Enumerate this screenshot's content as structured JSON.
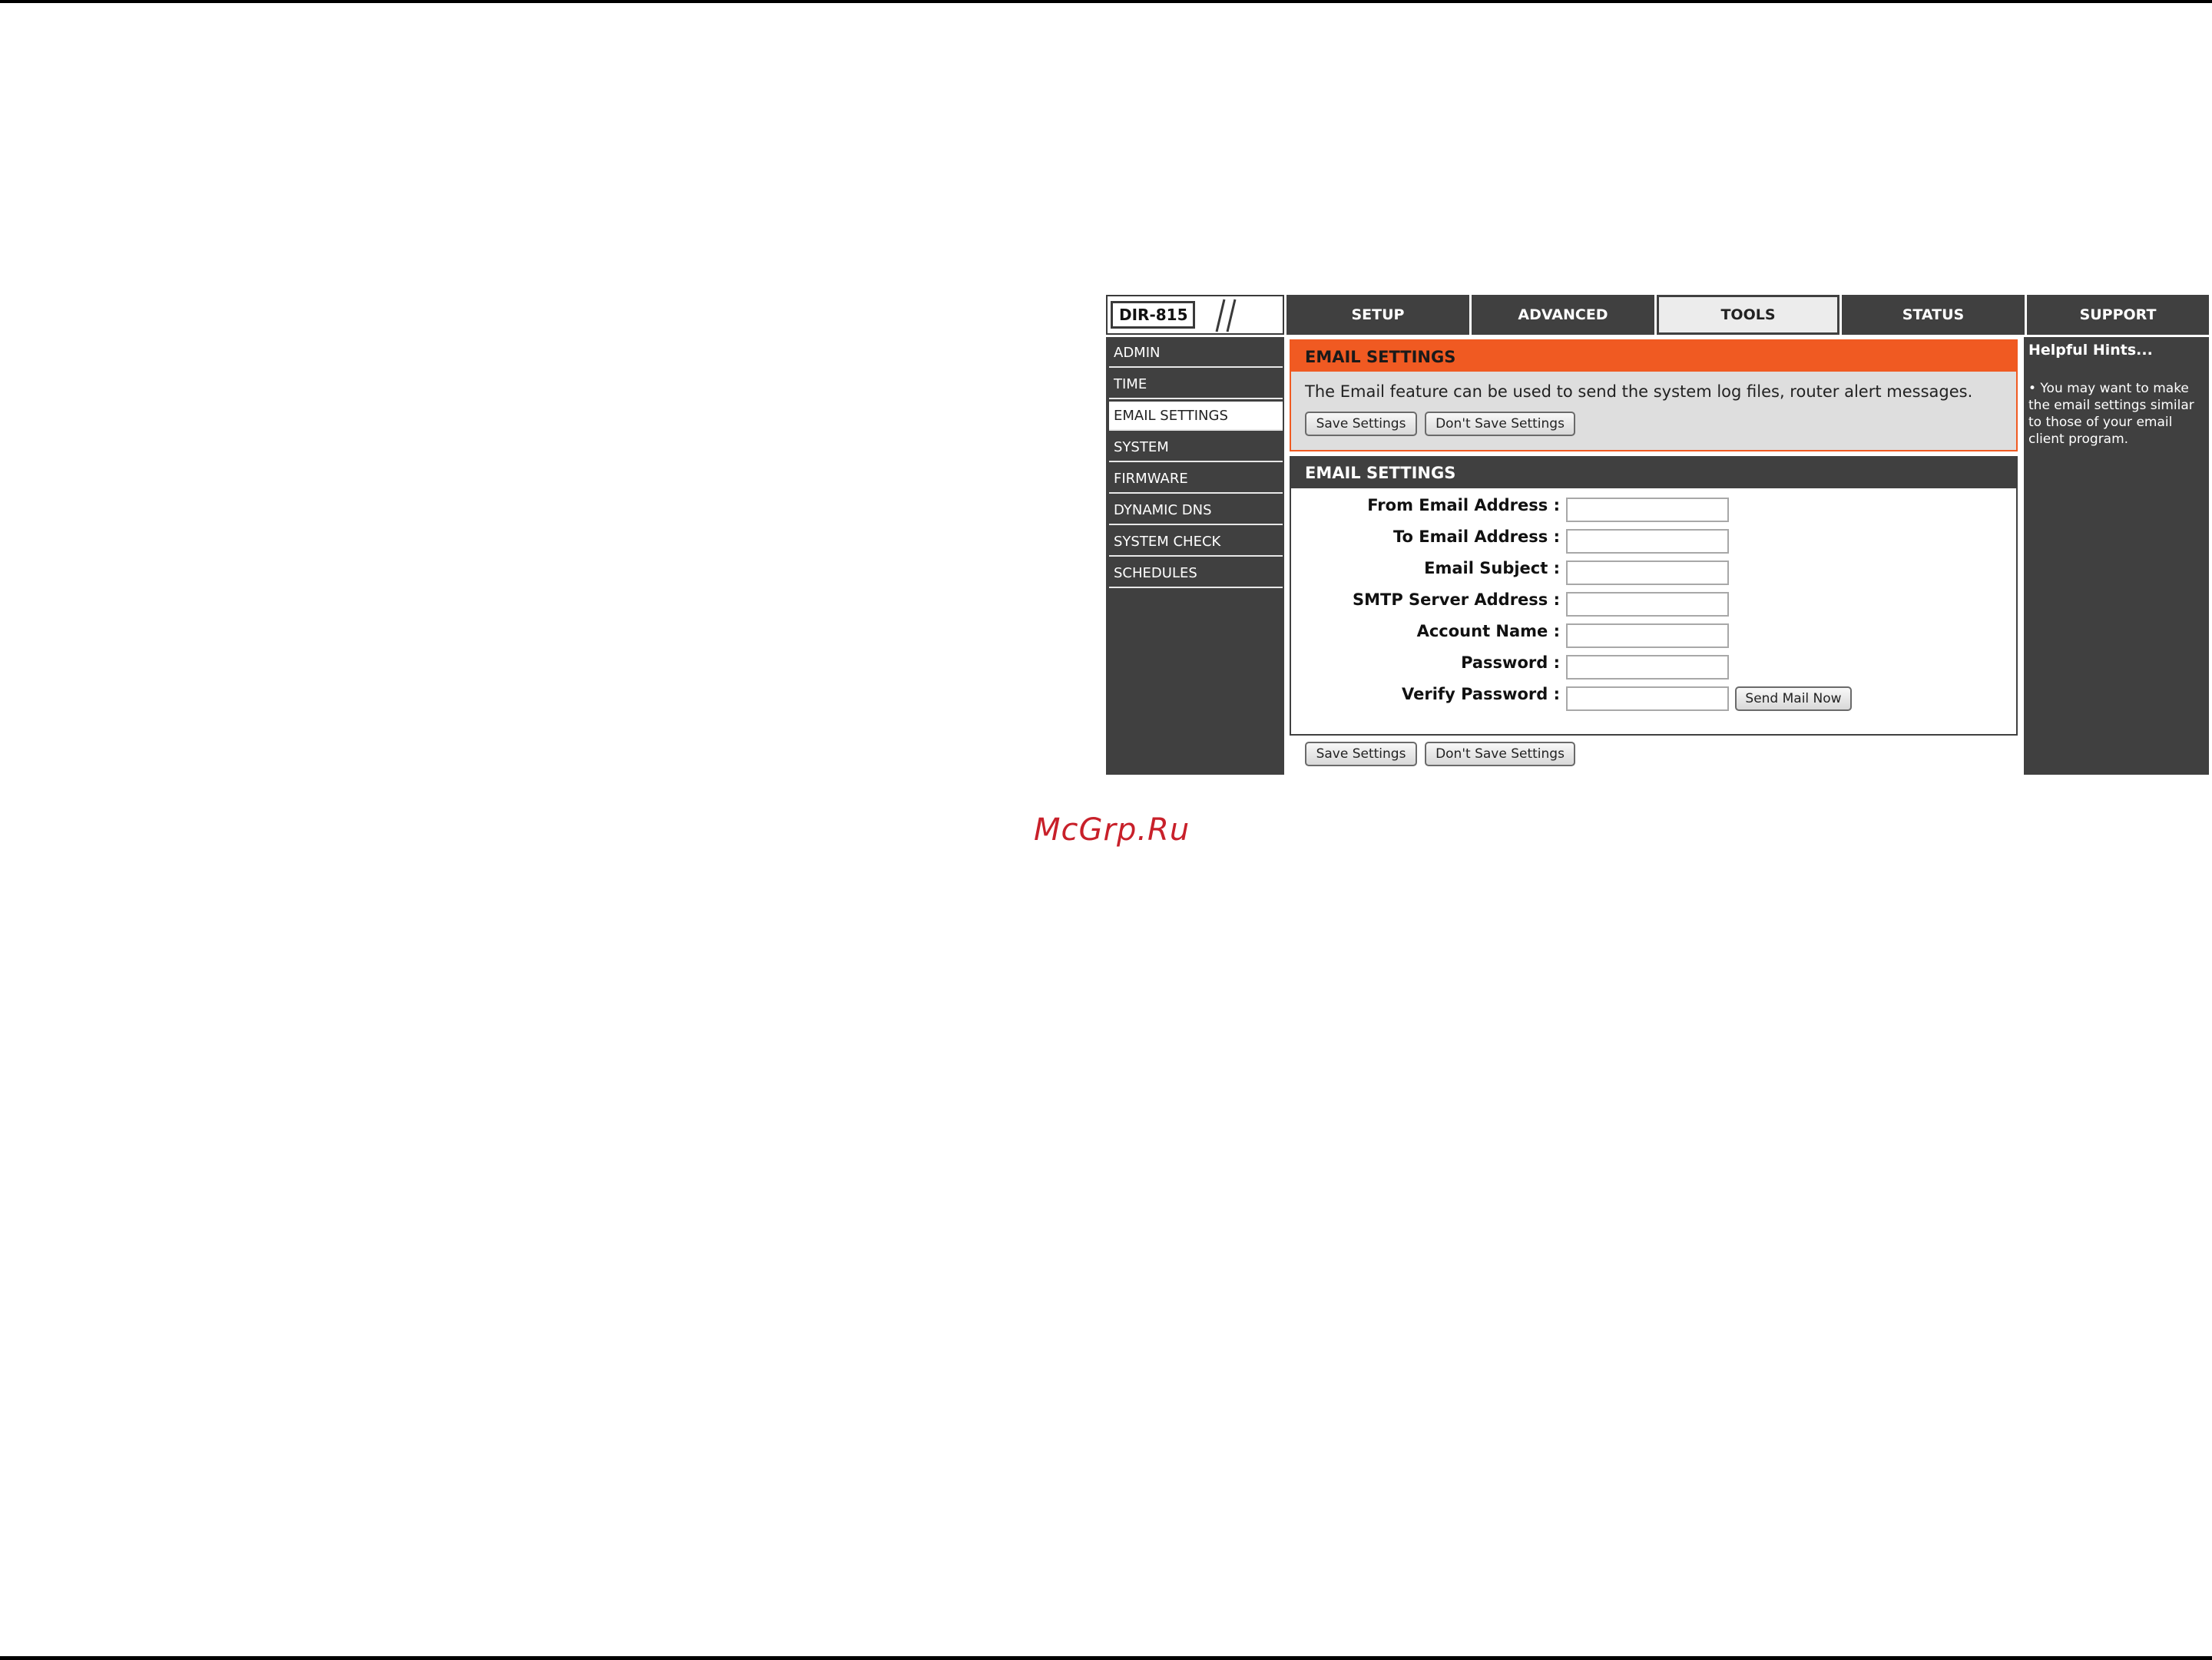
{
  "brand": {
    "model": "DIR-815"
  },
  "nav": {
    "tabs": [
      {
        "label": "SETUP"
      },
      {
        "label": "ADVANCED"
      },
      {
        "label": "TOOLS",
        "active": true
      },
      {
        "label": "STATUS"
      },
      {
        "label": "SUPPORT"
      }
    ]
  },
  "sidebar": {
    "items": [
      {
        "label": "ADMIN"
      },
      {
        "label": "TIME"
      },
      {
        "label": "EMAIL SETTINGS",
        "active": true
      },
      {
        "label": "SYSTEM"
      },
      {
        "label": "FIRMWARE"
      },
      {
        "label": "DYNAMIC DNS"
      },
      {
        "label": "SYSTEM CHECK"
      },
      {
        "label": "SCHEDULES"
      }
    ]
  },
  "intro": {
    "title": "EMAIL SETTINGS",
    "text": "The Email feature can be used to send the system log files, router alert messages.",
    "save_label": "Save Settings",
    "dont_save_label": "Don't Save Settings"
  },
  "email_form": {
    "title": "EMAIL SETTINGS",
    "fields": [
      {
        "label": "From Email Address :",
        "value": ""
      },
      {
        "label": "To Email Address :",
        "value": ""
      },
      {
        "label": "Email Subject :",
        "value": ""
      },
      {
        "label": "SMTP Server Address :",
        "value": ""
      },
      {
        "label": "Account Name :",
        "value": ""
      },
      {
        "label": "Password :",
        "value": ""
      },
      {
        "label": "Verify Password :",
        "value": ""
      }
    ],
    "send_mail_label": "Send Mail Now"
  },
  "bottom_buttons": {
    "save_label": "Save Settings",
    "dont_save_label": "Don't Save Settings"
  },
  "hints": {
    "title": "Helpful Hints...",
    "text": "• You may want to make the email settings similar to those of your email client program."
  },
  "watermark": "McGrp.Ru",
  "colors": {
    "accent": "#f05a22",
    "nav": "#404040",
    "panel": "#dedede"
  }
}
